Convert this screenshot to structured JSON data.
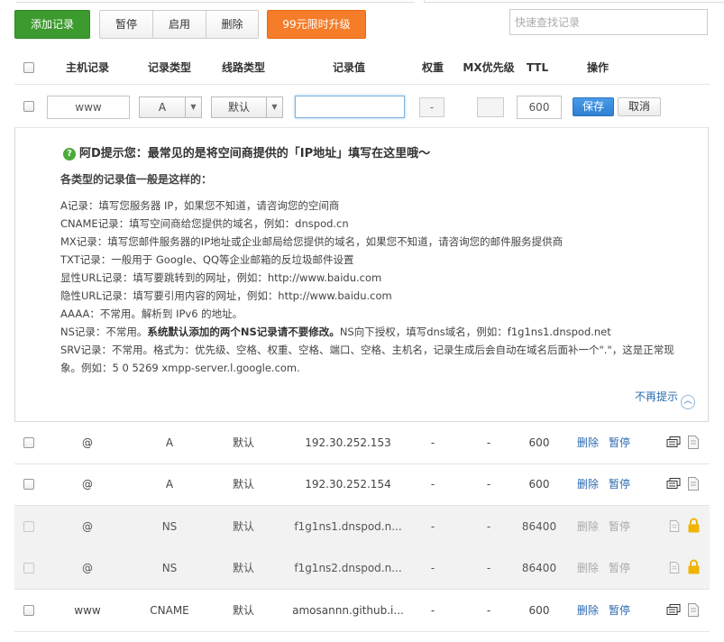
{
  "toolbar": {
    "add_label": "添加记录",
    "pause_label": "暂停",
    "enable_label": "启用",
    "delete_label": "删除",
    "upgrade_label": "99元限时升级",
    "search_placeholder": "快速查找记录"
  },
  "table": {
    "headers": {
      "host": "主机记录",
      "type": "记录类型",
      "line": "线路类型",
      "value": "记录值",
      "weight": "权重",
      "mx": "MX优先级",
      "ttl": "TTL",
      "op": "操作"
    }
  },
  "edit_row": {
    "host": "www",
    "type": "A",
    "line": "默认",
    "value": "",
    "weight": "-",
    "ttl": "600",
    "save_label": "保存",
    "cancel_label": "取消"
  },
  "tip": {
    "title": "阿D提示您：最常见的是将空间商提供的「IP地址」填写在这里哦～",
    "subtitle": "各类型的记录值一般是这样的：",
    "lines": [
      "A记录：填写您服务器 IP，如果您不知道，请咨询您的空间商",
      "CNAME记录：填写空间商给您提供的域名，例如：dnspod.cn",
      "MX记录：填写您邮件服务器的IP地址或企业邮局给您提供的域名，如果您不知道，请咨询您的邮件服务提供商",
      "TXT记录：一般用于 Google、QQ等企业邮箱的反垃圾邮件设置",
      "显性URL记录：填写要跳转到的网址，例如：http://www.baidu.com",
      "隐性URL记录：填写要引用内容的网址，例如：http://www.baidu.com",
      "AAAA：不常用。解析到 IPv6 的地址。"
    ],
    "ns_prefix": "NS记录：不常用。",
    "ns_bold": "系统默认添加的两个NS记录请不要修改。",
    "ns_suffix": "NS向下授权，填写dns域名，例如：f1g1ns1.dnspod.net",
    "srv_line1": "SRV记录：不常用。格式为：优先级、空格、权重、空格、端口、空格、主机名，记录生成后会自动在域名后面补一个\".\"，这是正常现",
    "srv_line2": "象。例如：5 0 5269 xmpp-server.l.google.com.",
    "dismiss_label": "不再提示"
  },
  "records": [
    {
      "host": "@",
      "type": "A",
      "line": "默认",
      "value": "192.30.252.153",
      "weight": "-",
      "mx": "-",
      "ttl": "600",
      "delete": "删除",
      "pause": "暂停",
      "locked": false
    },
    {
      "host": "@",
      "type": "A",
      "line": "默认",
      "value": "192.30.252.154",
      "weight": "-",
      "mx": "-",
      "ttl": "600",
      "delete": "删除",
      "pause": "暂停",
      "locked": false
    },
    {
      "host": "@",
      "type": "NS",
      "line": "默认",
      "value": "f1g1ns1.dnspod.n...",
      "weight": "-",
      "mx": "-",
      "ttl": "86400",
      "delete": "删除",
      "pause": "暂停",
      "locked": true
    },
    {
      "host": "@",
      "type": "NS",
      "line": "默认",
      "value": "f1g1ns2.dnspod.n...",
      "weight": "-",
      "mx": "-",
      "ttl": "86400",
      "delete": "删除",
      "pause": "暂停",
      "locked": true
    },
    {
      "host": "www",
      "type": "CNAME",
      "line": "默认",
      "value": "amosannn.github.i...",
      "weight": "-",
      "mx": "-",
      "ttl": "600",
      "delete": "删除",
      "pause": "暂停",
      "locked": false
    }
  ],
  "colors": {
    "add_button": "#3c9a2e",
    "upgrade_button": "#f57c28",
    "save_button": "#2f7fd3",
    "link": "#2a6ab0",
    "lock": "#f0b400"
  }
}
